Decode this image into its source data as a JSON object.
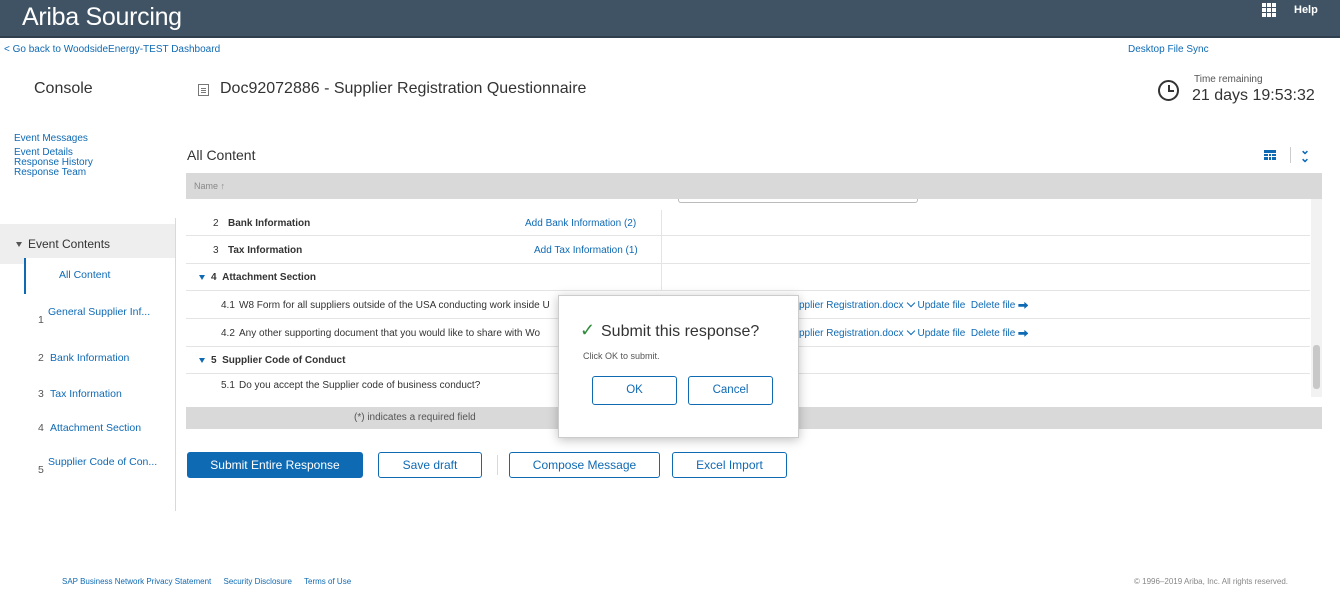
{
  "header": {
    "app_title": "Ariba Sourcing",
    "help": "Help"
  },
  "subbar": {
    "back_link": "< Go back to WoodsideEnergy-TEST Dashboard",
    "desktop_sync": "Desktop File Sync"
  },
  "title_row": {
    "console": "Console",
    "doc_title": "Doc92072886 - Supplier Registration Questionnaire",
    "time_label": "Time remaining",
    "time_value": "21 days 19:53:32"
  },
  "sidebar": {
    "links": [
      "Event Messages",
      "Event Details",
      "Response History",
      "Response Team"
    ],
    "event_contents": "Event Contents",
    "items": [
      {
        "num": "",
        "label": "All Content"
      },
      {
        "num": "1",
        "label": "General Supplier Inf..."
      },
      {
        "num": "2",
        "label": "Bank Information"
      },
      {
        "num": "3",
        "label": "Tax Information"
      },
      {
        "num": "4",
        "label": "Attachment Section"
      },
      {
        "num": "5",
        "label": "Supplier Code of Con..."
      }
    ]
  },
  "main": {
    "title": "All Content",
    "column_header": "Name ↑",
    "rows": [
      {
        "num": "2",
        "name": "Bank Information",
        "action": "Add Bank Information (2)"
      },
      {
        "num": "3",
        "name": "Tax Information",
        "action": "Add Tax Information (1)"
      },
      {
        "num": "4",
        "name": "Attachment Section"
      },
      {
        "num": "4.1",
        "name": "W8 Form for all suppliers outside of the USA conducting work inside U",
        "file": "pplier Registration.docx",
        "update": "Update file",
        "delete": "Delete file"
      },
      {
        "num": "4.2",
        "name": "Any other supporting document that you would like to share with Wo",
        "file": "pplier Registration.docx",
        "update": "Update file",
        "delete": "Delete file"
      },
      {
        "num": "5",
        "name": "Supplier Code of Conduct"
      },
      {
        "num": "5.1",
        "name": "Do you accept the Supplier code of business conduct?"
      }
    ],
    "footnote": "(*) indicates a required field"
  },
  "buttons": {
    "submit": "Submit Entire Response",
    "save": "Save draft",
    "compose": "Compose Message",
    "excel": "Excel Import"
  },
  "footer": {
    "links": [
      "SAP Business Network Privacy Statement",
      "Security Disclosure",
      "Terms of Use"
    ],
    "copyright": "© 1996–2019 Ariba, Inc. All rights reserved."
  },
  "modal": {
    "title": "Submit this response?",
    "text": "Click OK to submit.",
    "ok": "OK",
    "cancel": "Cancel"
  },
  "colors": {
    "header_bg": "#3f5364",
    "link": "#0f6ab4",
    "primary": "#0f6ab4",
    "check": "#2e8b3a"
  }
}
